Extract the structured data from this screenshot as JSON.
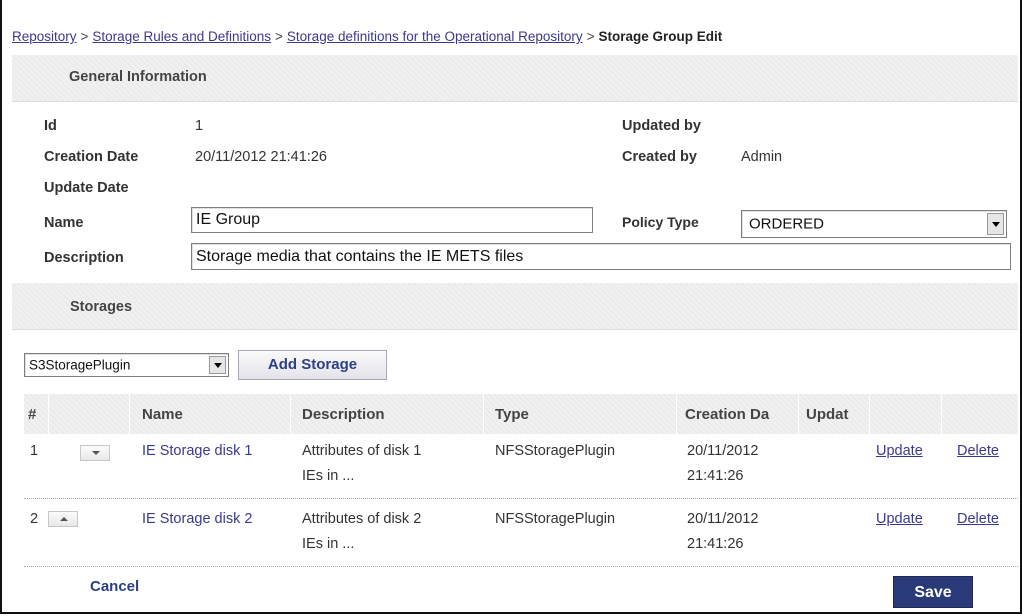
{
  "breadcrumb": {
    "items": [
      "Repository",
      "Storage Rules and Definitions",
      "Storage definitions for the Operational Repository"
    ],
    "separator": ">",
    "current": "Storage Group Edit"
  },
  "general": {
    "title": "General Information",
    "id_label": "Id",
    "id_value": "1",
    "creation_date_label": "Creation Date",
    "creation_date_value": "20/11/2012 21:41:26",
    "update_date_label": "Update Date",
    "update_date_value": "",
    "updated_by_label": "Updated by",
    "updated_by_value": "",
    "created_by_label": "Created by",
    "created_by_value": "Admin",
    "name_label": "Name",
    "name_value": "IE Group",
    "policy_type_label": "Policy Type",
    "policy_type_value": "ORDERED",
    "description_label": "Description",
    "description_value": "Storage media that contains the IE METS files"
  },
  "storages": {
    "title": "Storages",
    "plugin_select_value": "S3StoragePlugin",
    "add_button_label": "Add Storage",
    "columns": [
      "#",
      "",
      "Name",
      "Description",
      "Type",
      "Creation Da",
      "Updat",
      "",
      ""
    ],
    "rows": [
      {
        "num": "1",
        "name": "IE Storage disk 1",
        "description_line1": "Attributes of disk 1",
        "description_line2": "IEs in ...",
        "type": "NFSStoragePlugin",
        "creation_line1": "20/11/2012",
        "creation_line2": "21:41:26",
        "update": "",
        "update_action": "Update",
        "delete_action": "Delete"
      },
      {
        "num": "2",
        "name": "IE Storage disk 2",
        "description_line1": "Attributes of disk 2",
        "description_line2": "IEs in ...",
        "type": "NFSStoragePlugin",
        "creation_line1": "20/11/2012",
        "creation_line2": "21:41:26",
        "update": "",
        "update_action": "Update",
        "delete_action": "Delete"
      }
    ]
  },
  "footer": {
    "cancel_label": "Cancel",
    "save_label": "Save"
  },
  "colors": {
    "link": "#3a3a8c",
    "save_button": "#2a3a78",
    "header_bg": "#f0f0f0"
  }
}
